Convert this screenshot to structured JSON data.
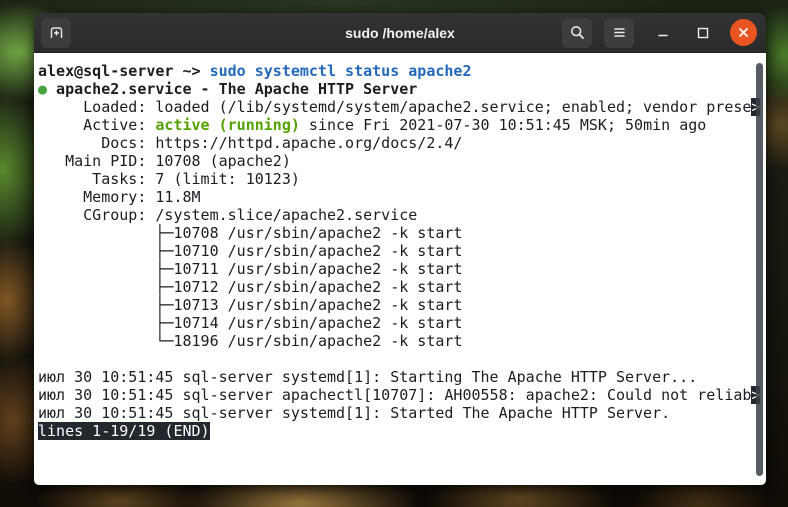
{
  "window": {
    "title": "sudo /home/alex"
  },
  "header": {
    "icons": {
      "new_tab": "tab-with-plus",
      "search": "magnifier",
      "menu": "hamburger-lines",
      "minimize": "dash",
      "maximize": "square-outline",
      "close": "x-cross"
    }
  },
  "colors": {
    "header_bg": "#2e2e2e",
    "header_button_bg": "#3d3d3d",
    "close_button_bg": "#e95420",
    "terminal_bg": "#ffffff",
    "terminal_fg": "#1b1d23",
    "command_blue": "#2368bd",
    "active_green": "#54a200",
    "status_dot_green": "#43a33c",
    "inverse_bg": "#23272e",
    "inverse_fg": "#ffffff"
  },
  "terminal": {
    "prompt": {
      "user_host": "alex@sql-server",
      "cwd_arrow": " ~> ",
      "command": "sudo systemctl status apache2"
    },
    "status": {
      "dot": "●",
      "unit_title": " apache2.service - The Apache HTTP Server",
      "loaded_text": "     Loaded: loaded (/lib/systemd/system/apache2.service; enabled; vendor prese",
      "loaded_trunc": ">",
      "active_label": "     Active: ",
      "active_state": "active (running)",
      "active_rest": " since Fri 2021-07-30 10:51:45 MSK; 50min ago",
      "docs": "       Docs: https://httpd.apache.org/docs/2.4/",
      "main_pid": "   Main PID: 10708 (apache2)",
      "tasks": "      Tasks: 7 (limit: 10123)",
      "memory": "     Memory: 11.8M",
      "cgroup": "     CGroup: /system.slice/apache2.service",
      "tree": [
        "             ├─10708 /usr/sbin/apache2 -k start",
        "             ├─10710 /usr/sbin/apache2 -k start",
        "             ├─10711 /usr/sbin/apache2 -k start",
        "             ├─10712 /usr/sbin/apache2 -k start",
        "             ├─10713 /usr/sbin/apache2 -k start",
        "             ├─10714 /usr/sbin/apache2 -k start",
        "             └─18196 /usr/sbin/apache2 -k start"
      ]
    },
    "journal": [
      {
        "text": "июл 30 10:51:45 sql-server systemd[1]: Starting The Apache HTTP Server..."
      },
      {
        "text": "июл 30 10:51:45 sql-server apachectl[10707]: AH00558: apache2: Could not reliab",
        "trunc": ">"
      },
      {
        "text": "июл 30 10:51:45 sql-server systemd[1]: Started The Apache HTTP Server."
      }
    ],
    "pager_status": "lines 1-19/19 (END)"
  }
}
